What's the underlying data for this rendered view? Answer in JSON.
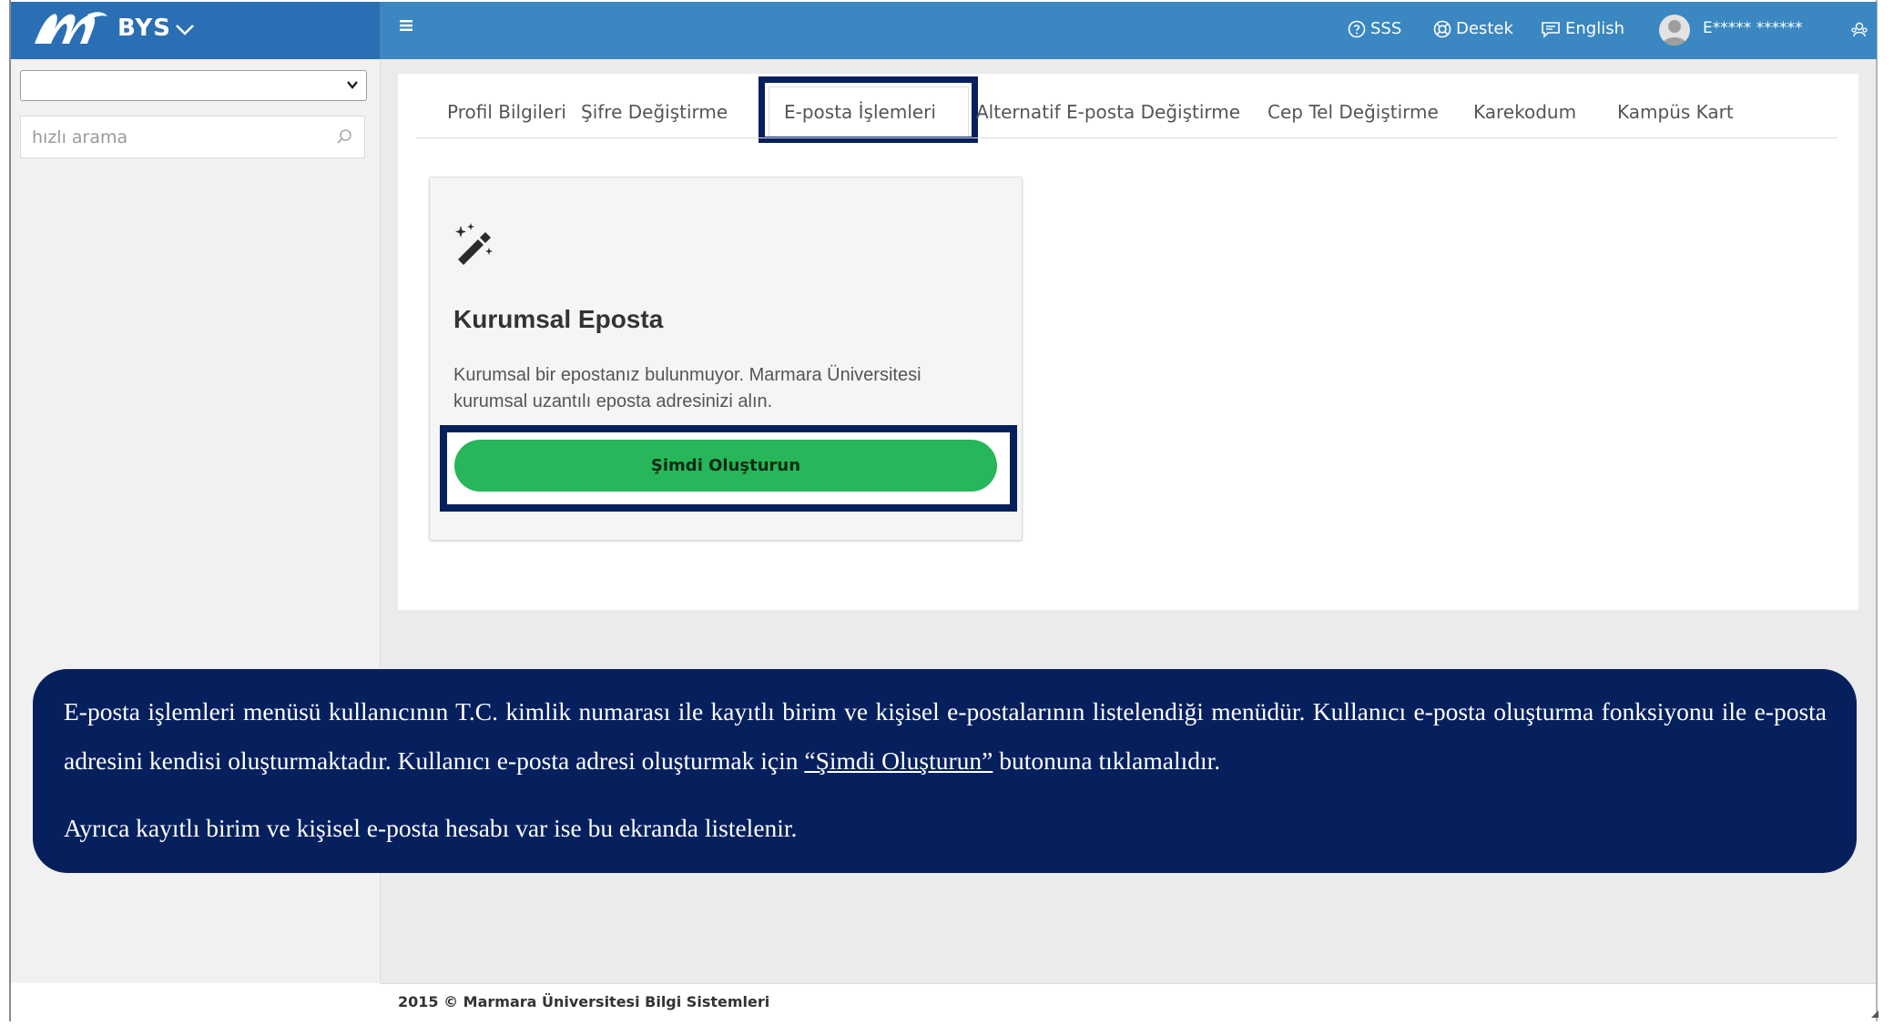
{
  "app": {
    "brand": "BYS"
  },
  "topnav": {
    "faq": "SSS",
    "support": "Destek",
    "language": "English",
    "user_name": "E***** ******"
  },
  "sidebar": {
    "select_value": "",
    "search_placeholder": "hızlı arama"
  },
  "tabs": [
    {
      "label": "Profil Bilgileri"
    },
    {
      "label": "Şifre Değiştirme"
    },
    {
      "label": "E-posta İşlemleri",
      "active": true
    },
    {
      "label": "Alternatif E-posta Değiştirme"
    },
    {
      "label": "Cep Tel Değiştirme"
    },
    {
      "label": "Karekodum"
    },
    {
      "label": "Kampüs Kart"
    }
  ],
  "card": {
    "icon": "magic-wand-icon",
    "title": "Kurumsal Eposta",
    "description": "Kurumsal bir epostanız bulunmuyor. Marmara Üniversitesi kurumsal uzantılı eposta adresinizi alın.",
    "button_label": "Şimdi Oluşturun"
  },
  "callout": {
    "para1_before": "E-posta işlemleri menüsü kullanıcının T.C. kimlik numarası ile  kayıtlı birim ve kişisel e-postalarının listelendiği menüdür. Kullanıcı e-posta oluşturma fonksiyonu ile e-posta adresini kendisi oluşturmaktadır. Kullanıcı e-posta adresi  oluşturmak için ",
    "para1_link": "“Şimdi Oluşturun”",
    "para1_after": " butonuna tıklamalıdır.",
    "para2": "Ayrıca kayıtlı birim ve kişisel e-posta hesabı var ise bu ekranda listelenir."
  },
  "footer": {
    "text": "2015 © Marmara Üniversitesi Bilgi Sistemleri"
  },
  "colors": {
    "topbar": "#3a87c2",
    "brand_bg": "#2a6fb4",
    "highlight": "#06205e",
    "button": "#27b65a"
  }
}
